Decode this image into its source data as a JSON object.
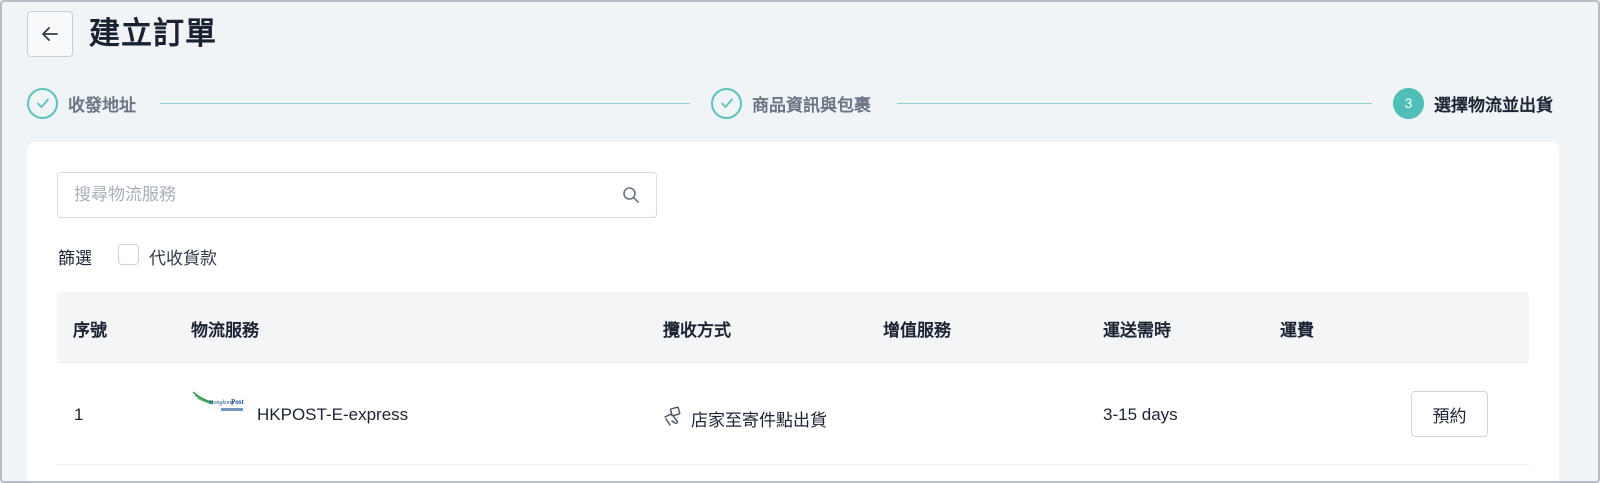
{
  "header": {
    "title": "建立訂單"
  },
  "steps": [
    {
      "label": "收發地址",
      "state": "done"
    },
    {
      "label": "商品資訊與包裹",
      "state": "done"
    },
    {
      "label": "選擇物流並出貨",
      "state": "active",
      "number": "3"
    }
  ],
  "search": {
    "placeholder": "搜尋物流服務",
    "value": ""
  },
  "filter": {
    "label": "篩選",
    "options": [
      {
        "label": "代收貨款",
        "checked": false
      }
    ]
  },
  "table": {
    "columns": [
      "序號",
      "物流服務",
      "攬收方式",
      "增值服務",
      "運送需時",
      "運費"
    ],
    "rows": [
      {
        "index": "1",
        "service": "HKPOST-E-express",
        "logo_icon": "hongkong-post-logo",
        "pickup_icon": "hand-package-icon",
        "pickup": "店家至寄件點出貨",
        "value_added": "",
        "duration": "3-15 days",
        "fee": "",
        "action": "預約"
      }
    ]
  },
  "colors": {
    "accent": "#4fbfb7",
    "background": "#f0f4f7",
    "card": "#ffffff"
  }
}
